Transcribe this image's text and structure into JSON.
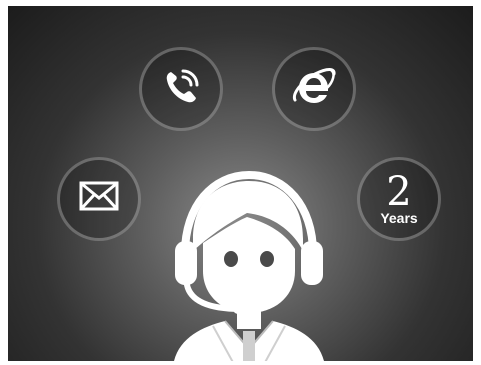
{
  "colors": {
    "background_center": "#8a8a8a",
    "background_edge": "#1c1c1c",
    "icon_color": "#ffffff"
  },
  "icons": {
    "phone": "phone-icon",
    "browser": "internet-explorer-icon",
    "mail": "envelope-icon",
    "agent": "support-agent-headset-illustration"
  },
  "experience": {
    "number": "2",
    "label": "Years"
  }
}
